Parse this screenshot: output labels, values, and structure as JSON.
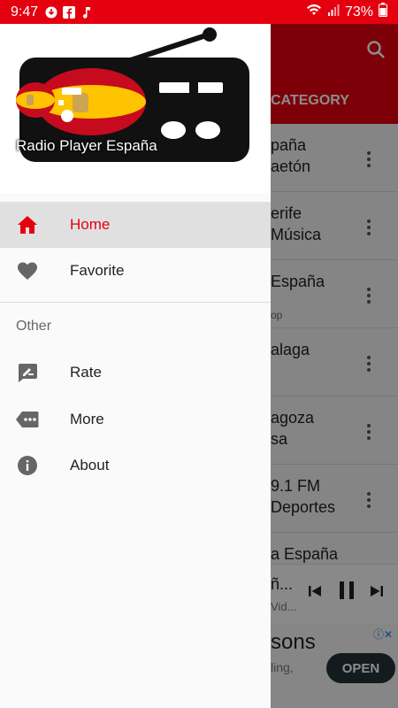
{
  "status_bar": {
    "time": "9:47",
    "battery": "73%"
  },
  "background": {
    "tab_label": "CATEGORY",
    "rows": [
      {
        "l1": "paña",
        "l2": "aetón",
        "sub": ""
      },
      {
        "l1": "erife",
        "l2": "Música",
        "sub": ""
      },
      {
        "l1": "España",
        "l2": "",
        "sub": "op"
      },
      {
        "l1": "alaga",
        "l2": "",
        "sub": ""
      },
      {
        "l1": "agoza",
        "l2": "sa",
        "sub": ""
      },
      {
        "l1": "9.1 FM",
        "l2": "Deportes",
        "sub": ""
      },
      {
        "l1": "a España",
        "l2": "",
        "sub": ""
      }
    ],
    "player": {
      "title": "ñ...",
      "subtitle": "Vid..."
    },
    "ad": {
      "headline": "sons",
      "subline": "ling,",
      "open_label": "OPEN"
    }
  },
  "drawer": {
    "header_title": "Radio Player España",
    "items": [
      {
        "label": "Home",
        "icon": "home-icon",
        "active": true
      },
      {
        "label": "Favorite",
        "icon": "heart-icon",
        "active": false
      }
    ],
    "section_title": "Other",
    "other_items": [
      {
        "label": "Rate",
        "icon": "rate-icon"
      },
      {
        "label": "More",
        "icon": "more-icon"
      },
      {
        "label": "About",
        "icon": "info-icon"
      }
    ]
  },
  "colors": {
    "accent": "#e4000f",
    "active_bg": "#e0e0e0"
  }
}
